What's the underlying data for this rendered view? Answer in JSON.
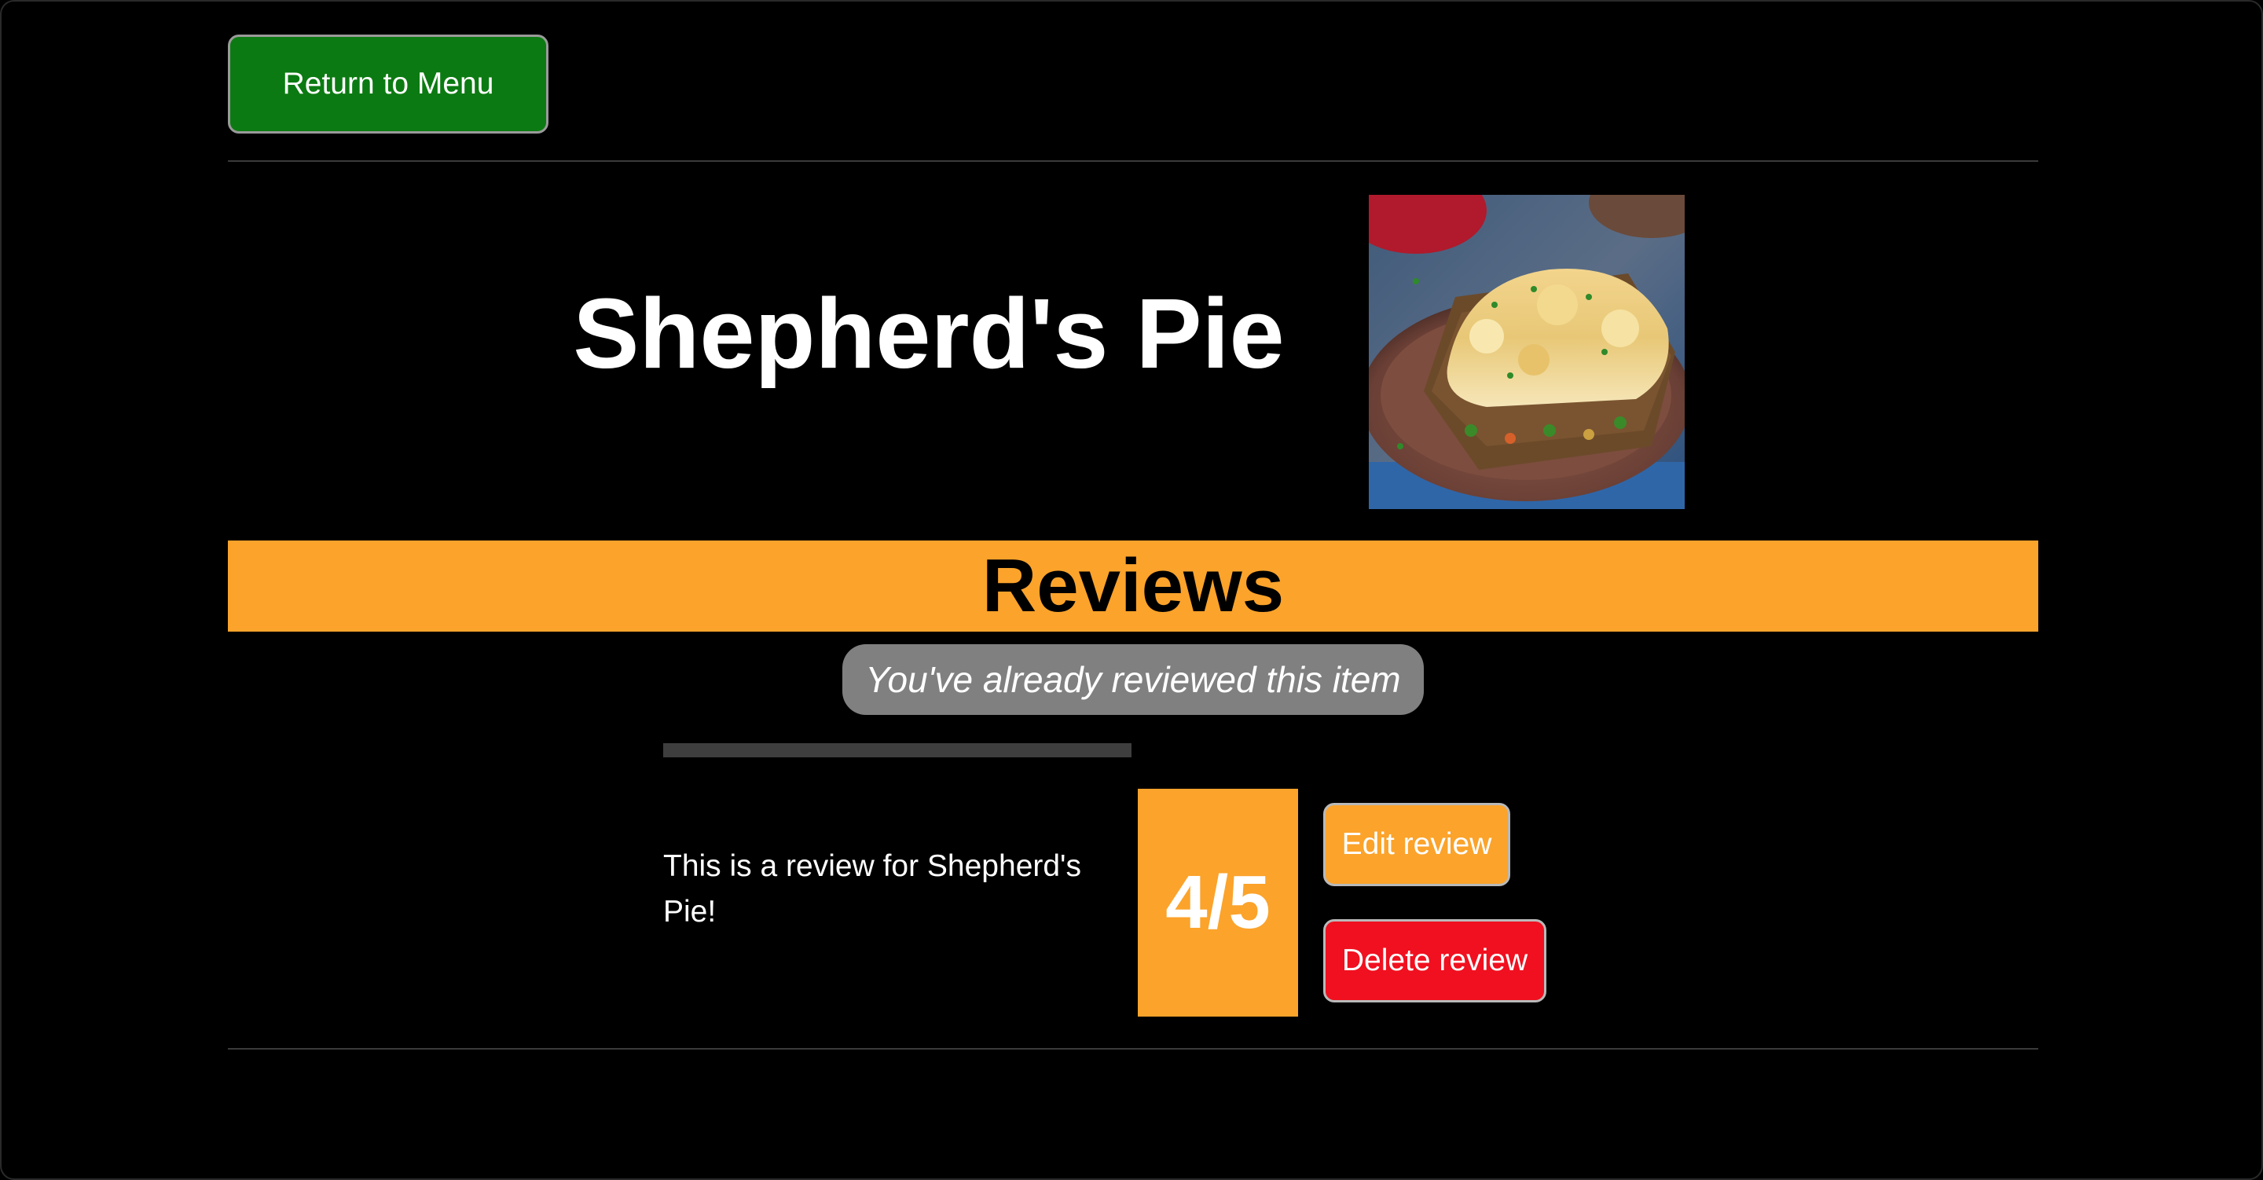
{
  "nav": {
    "return_label": "Return to Menu"
  },
  "item": {
    "name": "Shepherd's Pie",
    "image_alt": "Shepherd's Pie"
  },
  "reviews": {
    "heading": "Reviews",
    "notice": "You've already reviewed this item",
    "list": [
      {
        "text": "This is a review for Shepherd's Pie!",
        "rating_display": "4/5",
        "rating": 4,
        "rating_max": 5,
        "edit_label": "Edit review",
        "delete_label": "Delete review"
      }
    ]
  },
  "colors": {
    "return_button": "#0c7a12",
    "accent_orange": "#fba32b",
    "delete_red": "#f0101f",
    "notice_gray": "#808080",
    "background": "#000000"
  }
}
